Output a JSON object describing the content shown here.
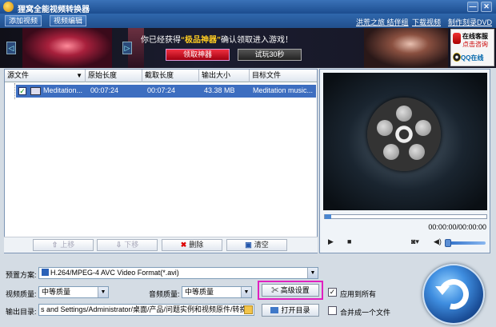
{
  "window": {
    "title": "狸窝全能视频转换器",
    "min_label": "—",
    "close_label": "✕"
  },
  "menu": {
    "add_video": "添加视频",
    "edit_video": "视频编辑",
    "links": [
      "洪荒之旅 结伴组",
      "下载视频",
      "制作刻录DVD"
    ]
  },
  "banner": {
    "text_pre": "你已经获得",
    "text_highlight": "“极品神器”",
    "text_post": "确认领取进入游戏！",
    "claim_button": "领取神器",
    "trial_button": "试玩30秒",
    "left_arrow": "◁",
    "right_arrow": "▷",
    "cs_title": "在线客服",
    "cs_sub": "点击咨询",
    "cs_qq": "QQ在线"
  },
  "table": {
    "headers": [
      "源文件",
      "原始长度",
      "截取长度",
      "输出大小",
      "目标文件"
    ],
    "rows": [
      {
        "source": "Meditation...",
        "orig_len": "00:07:24",
        "cut_len": "00:07:24",
        "size": "43.38 MB",
        "target": "Meditation music..."
      }
    ]
  },
  "list_tools": {
    "up": "上移",
    "down": "下移",
    "delete": "删除",
    "clear": "清空"
  },
  "preview": {
    "timecode": "00:00:00/00:00:00",
    "seek_fraction": 0,
    "volume_fraction": 1
  },
  "settings": {
    "preset_label": "预置方案:",
    "preset_value": "H.264/MPEG-4 AVC Video Format(*.avi)",
    "video_quality_label": "视频质量:",
    "video_quality_value": "中等质量",
    "audio_quality_label": "音频质量:",
    "audio_quality_value": "中等质量",
    "advanced_button": "高级设置",
    "apply_all_label": "应用到所有",
    "apply_all_checked": true,
    "output_dir_label": "输出目录:",
    "output_dir_value": "s and Settings/Administrator/桌面/产品/问题实例和视频原件/转换",
    "open_dir_button": "打开目录",
    "merge_label": "合并成一个文件",
    "merge_checked": false
  },
  "colors": {
    "highlight_box": "#e020c0",
    "selected_row": "#3d6ec0",
    "title_bar": "#2a5fa8"
  }
}
